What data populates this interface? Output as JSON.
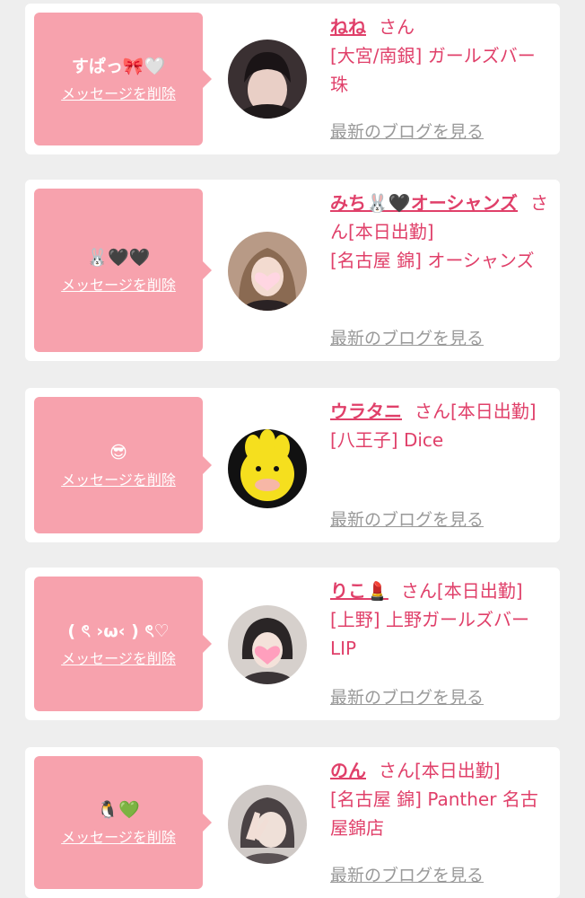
{
  "cards": [
    {
      "message": "すぱっ🎀🤍",
      "delete_label": "メッセージを削除",
      "name": "ねね",
      "suffix": "さん",
      "status": "",
      "shop": "[大宮/南銀] ガールズバー 珠",
      "blog_label": "最新のブログを見る"
    },
    {
      "message": "🐰🖤🖤",
      "delete_label": "メッセージを削除",
      "name": "みち🐰🖤オーシャンズ",
      "suffix": "さん",
      "status": "[本日出勤]",
      "shop": "[名古屋 錦] オーシャンズ",
      "blog_label": "最新のブログを見る"
    },
    {
      "message": "😎",
      "delete_label": "メッセージを削除",
      "name": "ウラタニ",
      "suffix": "さん",
      "status": "[本日出勤]",
      "shop": "[八王子] Dice",
      "blog_label": "最新のブログを見る"
    },
    {
      "message": "( ৎ ›ω‹ ) ৎ♡",
      "delete_label": "メッセージを削除",
      "name": "りこ💄",
      "suffix": "さん",
      "status": "[本日出勤]",
      "shop": "[上野] 上野ガールズバーLIP",
      "blog_label": "最新のブログを見る"
    },
    {
      "message": "🐧💚",
      "delete_label": "メッセージを削除",
      "name": "のん",
      "suffix": "さん",
      "status": "[本日出勤]",
      "shop": "[名古屋 錦] Panther 名古屋錦店",
      "blog_label": "最新のブログを見る"
    }
  ]
}
